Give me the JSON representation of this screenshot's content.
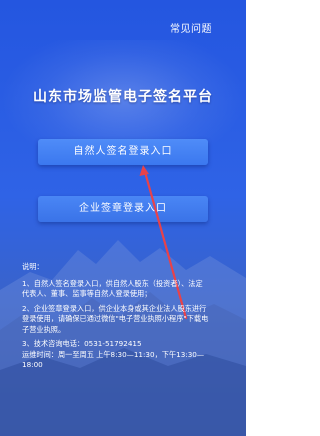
{
  "header": {
    "faq_link": "常见问题"
  },
  "title": "山东市场监管电子签名平台",
  "buttons": {
    "personal_login": "自然人签名登录入口",
    "enterprise_login": "企业签章登录入口"
  },
  "notes": {
    "heading": "说明：",
    "item1": {
      "line1": "1、自然人签名登录入口，供自然人股东（投资者）、法定",
      "line2": "代表人、董事、监事等自然人登录使用；"
    },
    "item2": {
      "line1": "2、企业签章登录入口，供企业本身或其企业法人股东进行",
      "line2": "登录使用，请确保已通过微信\"电子营业执照小程序\"下载电",
      "line3": "子营业执照。"
    },
    "item3": {
      "line1": "3、技术咨询电话：0531-51792415",
      "line2": "运维时间：周一至周五 上午8:30—11:30，下午13:30—",
      "line3": "18:00"
    }
  },
  "colors": {
    "background_top": "#2456e0",
    "button": "#4a86f5",
    "annotation_arrow": "#e8424a"
  }
}
